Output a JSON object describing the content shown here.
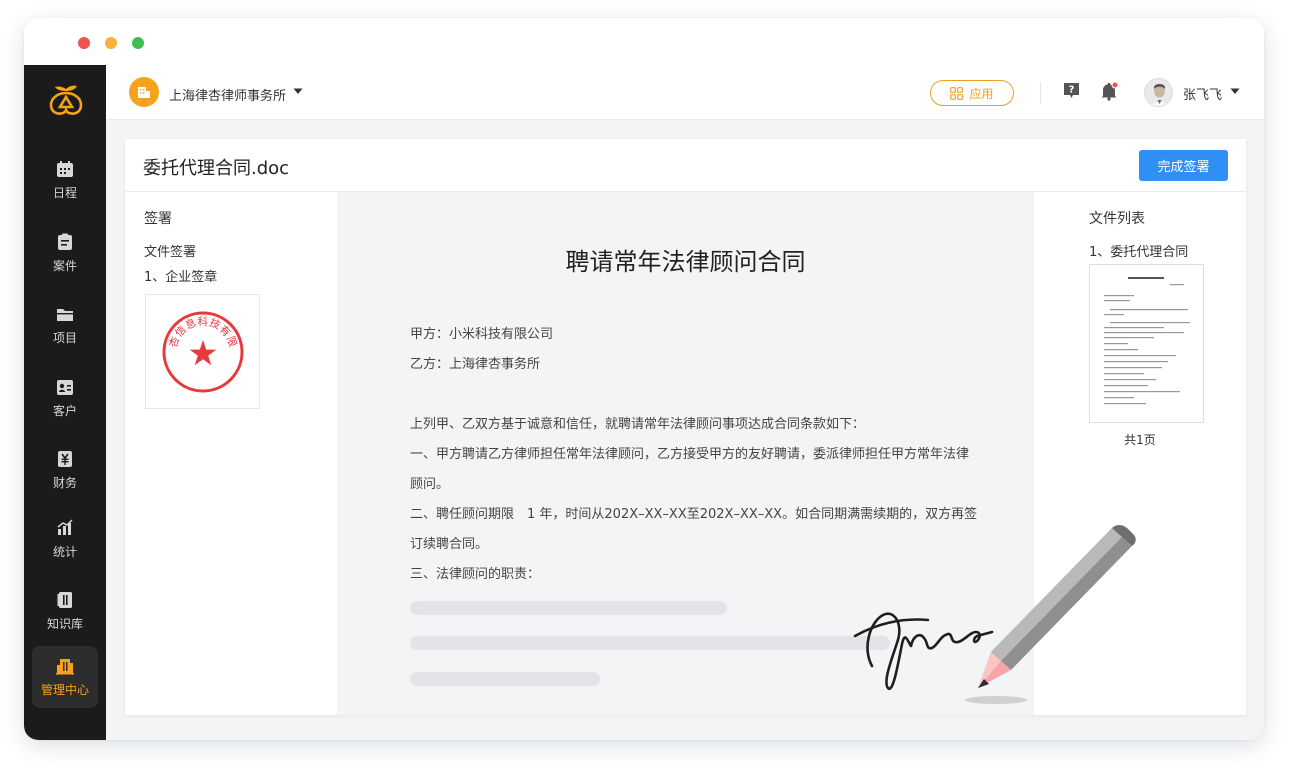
{
  "sidebar": {
    "items": [
      {
        "label": "日程",
        "icon": "calendar-icon"
      },
      {
        "label": "案件",
        "icon": "case-icon"
      },
      {
        "label": "项目",
        "icon": "folder-icon"
      },
      {
        "label": "客户",
        "icon": "client-icon"
      },
      {
        "label": "财务",
        "icon": "finance-icon"
      },
      {
        "label": "统计",
        "icon": "chart-icon"
      },
      {
        "label": "知识库",
        "icon": "book-icon"
      },
      {
        "label": "管理中心",
        "icon": "building-icon"
      }
    ],
    "active": "管理中心"
  },
  "header": {
    "org_name": "上海律杏律师事务所",
    "apps_label": "应用",
    "user_name": "张飞飞"
  },
  "document": {
    "file_name": "委托代理合同.doc",
    "finish_label": "完成签署",
    "title": "聘请常年法律顾问合同",
    "lines": [
      "甲方：小米科技有限公司",
      "乙方：上海律杏事务所",
      "上列甲、乙双方基于诚意和信任，就聘请常年法律顾问事项达成合同条款如下：",
      "一、甲方聘请乙方律师担任常年法律顾问，乙方接受甲方的友好聘请，委派律师担任甲方常年法律",
      "顾问。",
      "二、聘任顾问期限　1 年，时间从202X–XX–XX至202X–XX–XX。如合同期满需续期的，双方再签",
      "订续聘合同。",
      "三、法律顾问的职责："
    ]
  },
  "sign_panel": {
    "heading": "签署",
    "sub": "文件签署",
    "item": "1、企业签章",
    "seal_text": "上海杏信息科技有限公司"
  },
  "file_panel": {
    "heading": "文件列表",
    "item": "1、委托代理合同",
    "pages": "共1页"
  },
  "colors": {
    "accent": "#f7a21b",
    "primary": "#2f8ff5",
    "sidebar_bg": "#1b1b1b",
    "seal_red": "#e8393d"
  }
}
